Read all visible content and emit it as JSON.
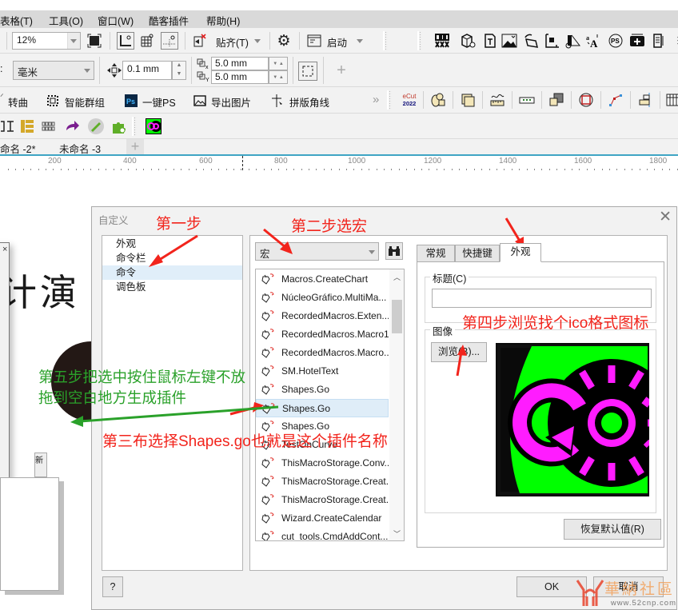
{
  "menu": [
    "表格(T)",
    "工具(O)",
    "窗口(W)",
    "酷客插件",
    "帮助(H)"
  ],
  "toolbar1": {
    "zoom_value": "12%",
    "snap_label": "贴齐(T)",
    "launch_label": "启动"
  },
  "toolbar2": {
    "unit_label_suffix": ":",
    "unit_value": "毫米",
    "nudge_value": "0.1 mm",
    "dup_x_value": "5.0 mm",
    "dup_y_value": "5.0 mm"
  },
  "toolbar3": {
    "items": [
      "转曲",
      "智能群组",
      "一键PS",
      "导出图片",
      "拼版角线"
    ],
    "overflow": "»",
    "ecut_label_top": "eCut",
    "ecut_label_bottom": "2022"
  },
  "doc_tabs": [
    "命名 -2*",
    "未命名 -3"
  ],
  "ruler": {
    "labels": [
      "200",
      "400",
      "600",
      "800",
      "1000",
      "1200",
      "1400",
      "1600",
      "1800"
    ]
  },
  "canvas": {
    "text": "计演",
    "new_tab_glyph": "新"
  },
  "dialog": {
    "title": "自定义",
    "tree": [
      "外观",
      "命令栏",
      "命令",
      "调色板"
    ],
    "tree_selected": 2,
    "category_value": "宏",
    "commands": [
      "Macros.CreateChart",
      "NúcleoGráfico.MultiMa...",
      "RecordedMacros.Exten...",
      "RecordedMacros.Macro1",
      "RecordedMacros.Macro...",
      "SM.HotelText",
      "Shapes.Go",
      "Shapes.Go",
      "Shapes.Go",
      "TestOnCurve",
      "ThisMacroStorage.Conv...",
      "ThisMacroStorage.Creat...",
      "ThisMacroStorage.Creat...",
      "Wizard.CreateCalendar",
      "cut_tools.CmdAddCont..."
    ],
    "commands_selected": 7,
    "tabs": [
      "常规",
      "快捷键",
      "外观"
    ],
    "active_tab": 2,
    "caption_group": "标题(C)",
    "caption_value": "",
    "image_group": "图像",
    "browse_button": "浏览(B)...",
    "restore_button": "恢复默认值(R)",
    "help_button": "?",
    "ok_button": "OK",
    "cancel_button": "取消"
  },
  "annotations": {
    "step1": "第一步",
    "step2": "第二步选宏",
    "step3": "第三布选择Shapes.go也就是这个插件名称",
    "step4": "第四步浏览找个ico格式图标",
    "step5_line1": "第五步把选中按住鼠标左键不放",
    "step5_line2": "拖到空白地方生成插件"
  },
  "watermark": {
    "text": "華納社區",
    "url": "www.52cnp.com"
  },
  "colors": {
    "annotation_red": "#f2241c",
    "annotation_green": "#2aa12a",
    "icon_green": "#00ff00",
    "icon_magenta": "#ff1cff",
    "selection_blue": "#e0eef9",
    "ruler_accent": "#3fa5c4"
  }
}
